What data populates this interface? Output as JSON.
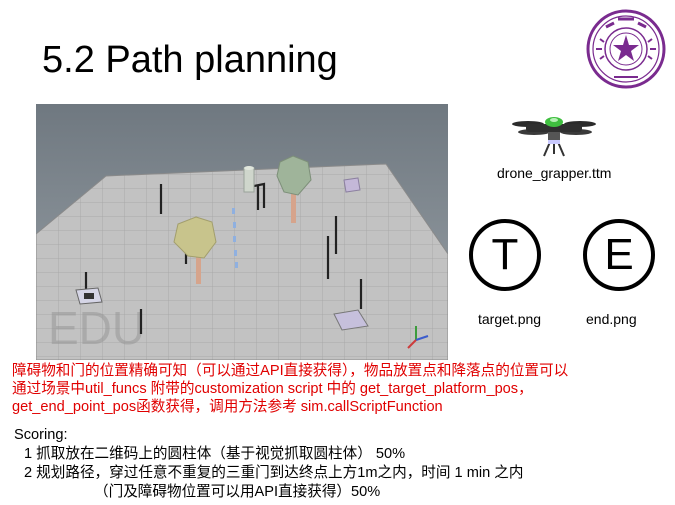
{
  "slide": {
    "title": "5.2 Path planning",
    "scene_watermark": "EDU",
    "drone_label": "drone_grapper.ttm",
    "target_icon_letter": "T",
    "end_icon_letter": "E",
    "target_label": "target.png",
    "end_label": "end.png",
    "note_line1": "障碍物和门的位置精确可知（可以通过API直接获得），物品放置点和降落点的位置可以",
    "note_line2": "通过场景中util_funcs 附带的customization script 中的 get_target_platform_pos，",
    "note_line3": "get_end_point_pos函数获得，调用方法参考 sim.callScriptFunction",
    "scoring_heading": "Scoring:",
    "scoring_item1": "1 抓取放在二维码上的圆柱体（基于视觉抓取圆柱体）  50%",
    "scoring_item2": "2  规划路径，穿过任意不重复的三重门到达终点上方1m之内，时间 1 min 之内",
    "scoring_item2_cont": "（门及障碍物位置可以用API直接获得）50%"
  },
  "colors": {
    "note_text": "#e00000",
    "logo_purple": "#7a2b8f",
    "floor_tile": "#bdbdbd",
    "sky_gray": "#808890"
  },
  "icons": {
    "logo": "tsinghua-university-seal-icon",
    "drone": "quadcopter-drone-icon"
  }
}
